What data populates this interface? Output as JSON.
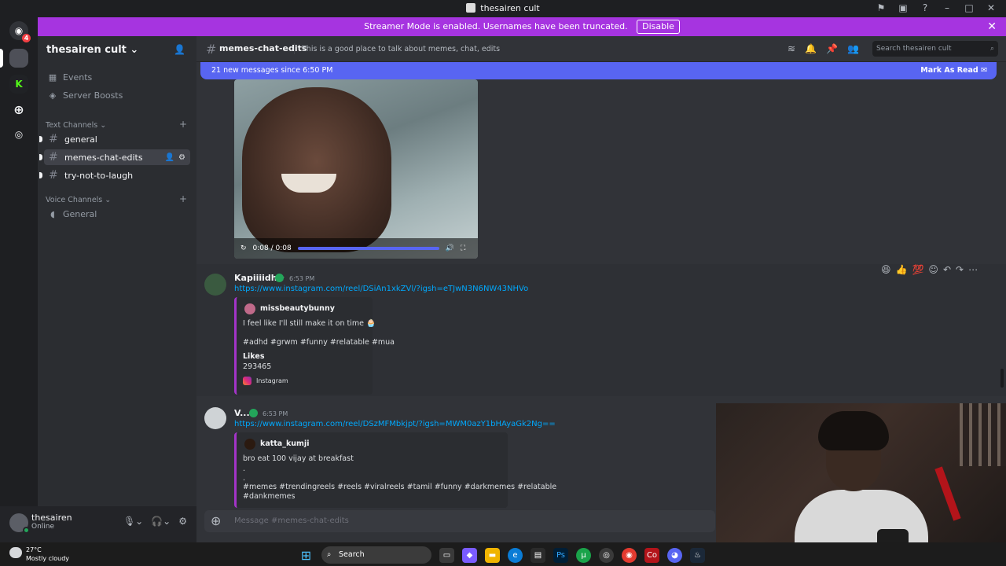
{
  "window": {
    "title": "thesairen cult"
  },
  "banner": {
    "text": "Streamer Mode is enabled. Usernames have been truncated.",
    "button": "Disable"
  },
  "guilds": {
    "discord_badge": "4"
  },
  "server": {
    "name": "thesairen cult"
  },
  "sidebar": {
    "events": "Events",
    "boosts": "Server Boosts",
    "text_category": "Text Channels",
    "text_channels": [
      "general",
      "memes-chat-edits",
      "try-not-to-laugh"
    ],
    "voice_category": "Voice Channels",
    "voice_channels": [
      "General"
    ]
  },
  "user": {
    "name": "thesairen",
    "status": "Online"
  },
  "channel": {
    "name": "memes-chat-edits",
    "topic": "This is a good place to talk about memes, chat, edits",
    "search_placeholder": "Search thesairen cult"
  },
  "new_messages": {
    "text": "21 new messages since 6:50 PM",
    "action": "Mark As Read"
  },
  "video": {
    "time": "0:08 / 0:08",
    "progress": 1.0
  },
  "messages": [
    {
      "author": "Kapiiiidh☆",
      "time": "6:53 PM",
      "link": "https://www.instagram.com/reel/DSiAn1xkZVl/?igsh=eTJwN3N6NW43NHVo",
      "embed": {
        "author": "missbeautybunny",
        "line1": "I feel like I'll still make it on time 🧁",
        "line2": "#adhd #grwm #funny #relatable #mua",
        "likes_label": "Likes",
        "likes": "293465",
        "provider": "Instagram"
      }
    },
    {
      "author": "V...",
      "time": "6:53 PM",
      "link": "https://www.instagram.com/reel/DSzMFMbkjpt/?igsh=MWM0azY1bHAyaGk2Ng==",
      "embed": {
        "author": "katta_kumji",
        "line1": "bro eat 100 vijay at breakfast",
        "line2": ".",
        "line3": ".",
        "line4": "#memes #trendingreels #reels #viralreels #tamil #funny #darkmemes #relatable",
        "line5": "#dankmemes"
      }
    }
  ],
  "composer": {
    "placeholder": "Message #memes-chat-edits"
  },
  "taskbar": {
    "temp": "27°C",
    "weather": "Mostly cloudy",
    "search": "Search"
  },
  "colors": {
    "accent": "#5865f2",
    "banner": "#a634e0",
    "link": "#00a8fc",
    "online": "#23a55a"
  }
}
